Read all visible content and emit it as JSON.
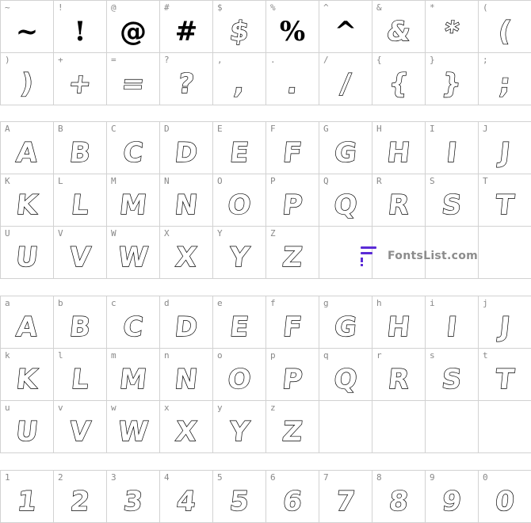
{
  "brand": {
    "text": "FontsList.com",
    "color": "#5b2bd6"
  },
  "symbols": [
    [
      {
        "key": "~",
        "glyph": "~"
      },
      {
        "key": "!",
        "glyph": "!"
      },
      {
        "key": "@",
        "glyph": "@"
      },
      {
        "key": "#",
        "glyph": "#"
      },
      {
        "key": "$",
        "glyph": "$"
      },
      {
        "key": "%",
        "glyph": "%"
      },
      {
        "key": "^",
        "glyph": "^"
      },
      {
        "key": "&",
        "glyph": "&"
      },
      {
        "key": "*",
        "glyph": "*"
      },
      {
        "key": "(",
        "glyph": "("
      }
    ],
    [
      {
        "key": ")",
        "glyph": ")"
      },
      {
        "key": "+",
        "glyph": "+"
      },
      {
        "key": "=",
        "glyph": "="
      },
      {
        "key": "?",
        "glyph": "?"
      },
      {
        "key": ",",
        "glyph": ","
      },
      {
        "key": ".",
        "glyph": "."
      },
      {
        "key": "/",
        "glyph": "/"
      },
      {
        "key": "{",
        "glyph": "{"
      },
      {
        "key": "}",
        "glyph": "}"
      },
      {
        "key": ";",
        "glyph": ";"
      }
    ]
  ],
  "uppercase": [
    [
      {
        "key": "A",
        "glyph": "A"
      },
      {
        "key": "B",
        "glyph": "B"
      },
      {
        "key": "C",
        "glyph": "C"
      },
      {
        "key": "D",
        "glyph": "D"
      },
      {
        "key": "E",
        "glyph": "E"
      },
      {
        "key": "F",
        "glyph": "F"
      },
      {
        "key": "G",
        "glyph": "G"
      },
      {
        "key": "H",
        "glyph": "H"
      },
      {
        "key": "I",
        "glyph": "I"
      },
      {
        "key": "J",
        "glyph": "J"
      }
    ],
    [
      {
        "key": "K",
        "glyph": "K"
      },
      {
        "key": "L",
        "glyph": "L"
      },
      {
        "key": "M",
        "glyph": "M"
      },
      {
        "key": "N",
        "glyph": "N"
      },
      {
        "key": "O",
        "glyph": "O"
      },
      {
        "key": "P",
        "glyph": "P"
      },
      {
        "key": "Q",
        "glyph": "Q"
      },
      {
        "key": "R",
        "glyph": "R"
      },
      {
        "key": "S",
        "glyph": "S"
      },
      {
        "key": "T",
        "glyph": "T"
      }
    ],
    [
      {
        "key": "U",
        "glyph": "U"
      },
      {
        "key": "V",
        "glyph": "V"
      },
      {
        "key": "W",
        "glyph": "W"
      },
      {
        "key": "X",
        "glyph": "X"
      },
      {
        "key": "Y",
        "glyph": "Y"
      },
      {
        "key": "Z",
        "glyph": "Z"
      }
    ]
  ],
  "lowercase": [
    [
      {
        "key": "a",
        "glyph": "A"
      },
      {
        "key": "b",
        "glyph": "B"
      },
      {
        "key": "c",
        "glyph": "C"
      },
      {
        "key": "d",
        "glyph": "D"
      },
      {
        "key": "e",
        "glyph": "E"
      },
      {
        "key": "f",
        "glyph": "F"
      },
      {
        "key": "g",
        "glyph": "G"
      },
      {
        "key": "h",
        "glyph": "H"
      },
      {
        "key": "i",
        "glyph": "I"
      },
      {
        "key": "j",
        "glyph": "J"
      }
    ],
    [
      {
        "key": "k",
        "glyph": "K"
      },
      {
        "key": "l",
        "glyph": "L"
      },
      {
        "key": "m",
        "glyph": "M"
      },
      {
        "key": "n",
        "glyph": "N"
      },
      {
        "key": "o",
        "glyph": "O"
      },
      {
        "key": "p",
        "glyph": "P"
      },
      {
        "key": "q",
        "glyph": "Q"
      },
      {
        "key": "r",
        "glyph": "R"
      },
      {
        "key": "s",
        "glyph": "S"
      },
      {
        "key": "t",
        "glyph": "T"
      }
    ],
    [
      {
        "key": "u",
        "glyph": "U"
      },
      {
        "key": "v",
        "glyph": "V"
      },
      {
        "key": "w",
        "glyph": "W"
      },
      {
        "key": "x",
        "glyph": "X"
      },
      {
        "key": "y",
        "glyph": "Y"
      },
      {
        "key": "z",
        "glyph": "Z"
      }
    ]
  ],
  "digits": [
    [
      {
        "key": "1",
        "glyph": "1"
      },
      {
        "key": "2",
        "glyph": "2"
      },
      {
        "key": "3",
        "glyph": "3"
      },
      {
        "key": "4",
        "glyph": "4"
      },
      {
        "key": "5",
        "glyph": "5"
      },
      {
        "key": "6",
        "glyph": "6"
      },
      {
        "key": "7",
        "glyph": "7"
      },
      {
        "key": "8",
        "glyph": "8"
      },
      {
        "key": "9",
        "glyph": "9"
      },
      {
        "key": "0",
        "glyph": "0"
      }
    ]
  ]
}
